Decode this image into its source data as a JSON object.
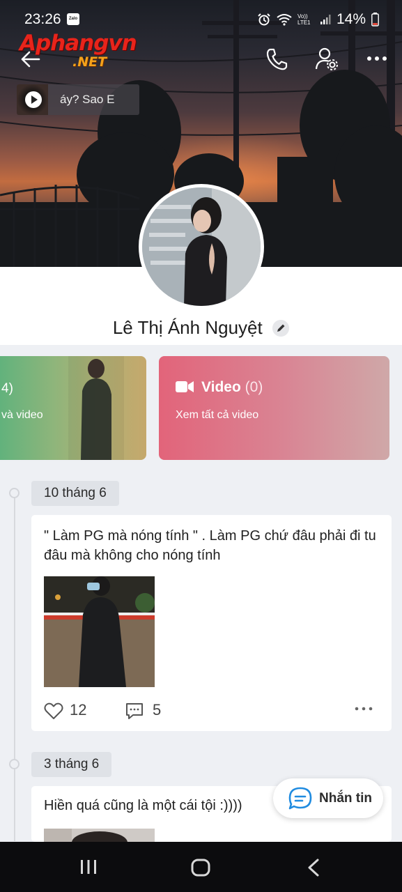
{
  "status_bar": {
    "time": "23:26",
    "app_badge": "Zalo",
    "network_label": "Vo)) LTE1",
    "battery": "14%"
  },
  "watermark": {
    "brand": "Aphangvn",
    "suffix": ".NET"
  },
  "music": {
    "ticker_text": "áy?      Sao E"
  },
  "profile": {
    "name": "Lê Thị Ánh Nguyệt"
  },
  "media": {
    "photos": {
      "count_fragment": "4)",
      "subtitle": "và video"
    },
    "video": {
      "title": "Video",
      "count": "(0)",
      "subtitle": "Xem tất cả video"
    }
  },
  "posts": [
    {
      "date": "10 tháng 6",
      "text": "\" Làm PG mà nóng tính \" . Làm PG chứ đâu phải đi tu đâu mà không cho nóng tính",
      "likes": "12",
      "comments": "5"
    },
    {
      "date": "3 tháng 6",
      "text": "Hiền quá cũng là một cái tội :))))"
    }
  ],
  "chat_button": {
    "label": "Nhắn tin"
  },
  "colors": {
    "video_card": "#e2647a",
    "photos_card": "#5cb27c",
    "chat_icon": "#1f8be0"
  }
}
